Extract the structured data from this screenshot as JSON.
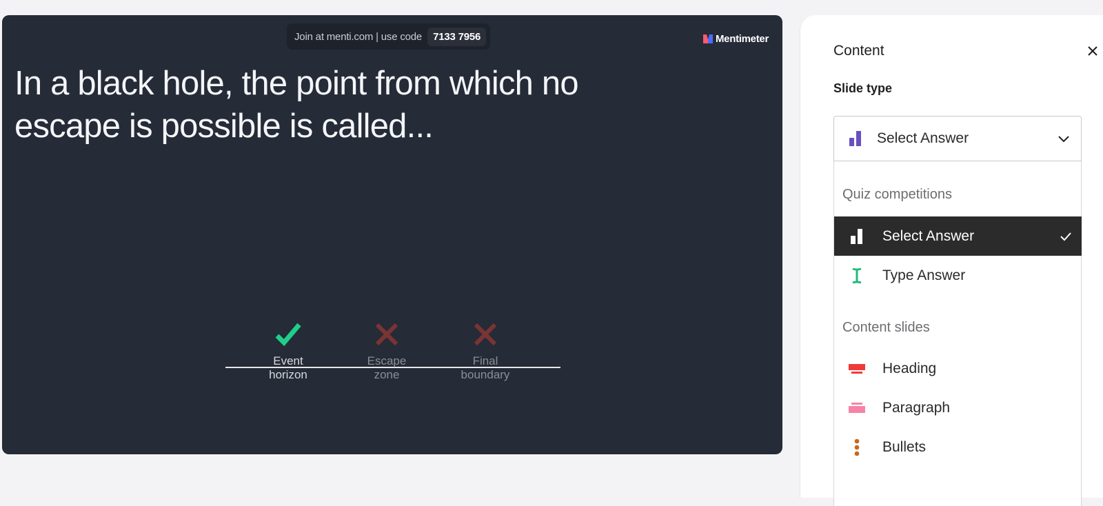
{
  "slide": {
    "join": {
      "text": "Join at menti.com | use code",
      "code": "7133 7956"
    },
    "brand": "Mentimeter",
    "question": "In a black hole, the point from which no escape is possible is called...",
    "answers": [
      {
        "label_line1": "Event",
        "label_line2": "horizon",
        "status": "correct",
        "icon": "check-icon",
        "color": "#1fce8a"
      },
      {
        "label_line1": "Escape",
        "label_line2": "zone",
        "status": "wrong",
        "icon": "cross-icon",
        "color": "#7a3434"
      },
      {
        "label_line1": "Final",
        "label_line2": "boundary",
        "status": "wrong",
        "icon": "cross-icon",
        "color": "#7a3434"
      }
    ]
  },
  "panel": {
    "title": "Content",
    "close_icon": "close-icon",
    "slide_type_label": "Slide type",
    "select": {
      "value": "Select Answer",
      "icon": "bar-chart-icon",
      "icon_color": "#6a4fc0"
    },
    "groups": [
      {
        "heading": "Quiz competitions",
        "options": [
          {
            "label": "Select Answer",
            "icon": "bar-chart-icon",
            "selected": true
          },
          {
            "label": "Type Answer",
            "icon": "text-cursor-icon",
            "icon_color": "#1fb97a",
            "selected": false
          }
        ]
      },
      {
        "heading": "Content slides",
        "options": [
          {
            "label": "Heading",
            "icon": "heading-icon",
            "icon_color": "#f03a3a",
            "selected": false
          },
          {
            "label": "Paragraph",
            "icon": "paragraph-icon",
            "icon_color": "#f783a8",
            "selected": false
          },
          {
            "label": "Bullets",
            "icon": "bullets-icon",
            "icon_color": "#c9661b",
            "selected": false
          }
        ]
      }
    ]
  }
}
